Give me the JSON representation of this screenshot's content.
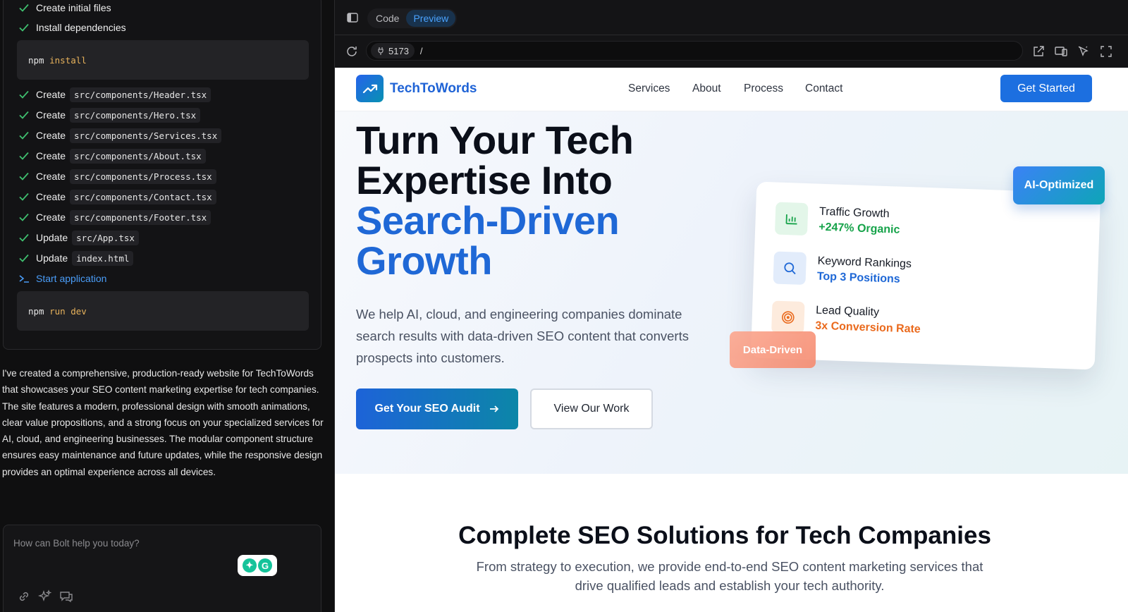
{
  "steps": [
    {
      "verb": "Create initial files",
      "file": ""
    },
    {
      "verb": "Install dependencies",
      "file": ""
    },
    {
      "verb": "Create",
      "file": "src/components/Header.tsx"
    },
    {
      "verb": "Create",
      "file": "src/components/Hero.tsx"
    },
    {
      "verb": "Create",
      "file": "src/components/Services.tsx"
    },
    {
      "verb": "Create",
      "file": "src/components/About.tsx"
    },
    {
      "verb": "Create",
      "file": "src/components/Process.tsx"
    },
    {
      "verb": "Create",
      "file": "src/components/Contact.tsx"
    },
    {
      "verb": "Create",
      "file": "src/components/Footer.tsx"
    },
    {
      "verb": "Update",
      "file": "src/App.tsx"
    },
    {
      "verb": "Update",
      "file": "index.html"
    },
    {
      "verb": "Start application",
      "file": ""
    }
  ],
  "terminals": [
    {
      "cmd": "npm",
      "arg": "install"
    },
    {
      "cmd": "npm",
      "arg": "run dev"
    }
  ],
  "summary": "I've created a comprehensive, production-ready website for TechToWords that showcases your SEO content marketing expertise for tech companies. The site features a modern, professional design with smooth animations, clear value propositions, and a strong focus on your specialized services for AI, cloud, and engineering businesses. The modular component structure ensures easy maintenance and future updates, while the responsive design provides an optimal experience across all devices.",
  "chat": {
    "placeholder": "How can Bolt help you today?"
  },
  "tabs": {
    "code": "Code",
    "preview": "Preview"
  },
  "address": {
    "port": "5173",
    "path": "/"
  },
  "site": {
    "brand": "TechToWords",
    "nav": [
      "Services",
      "About",
      "Process",
      "Contact"
    ],
    "cta": "Get Started",
    "hero": {
      "line1": "Turn Your Tech",
      "line2": "Expertise Into",
      "line3": "Search-Driven",
      "line4": "Growth",
      "desc": "We help AI, cloud, and engineering companies dominate search results with data-driven SEO content that converts prospects into customers.",
      "primary": "Get Your SEO Audit",
      "secondary": "View Our Work"
    },
    "metrics": [
      {
        "title": "Traffic Growth",
        "value": "+247% Organic",
        "color": "#16a34a",
        "bg": "#e3f6e9",
        "icon": "bar-chart-icon"
      },
      {
        "title": "Keyword Rankings",
        "value": "Top 3 Positions",
        "color": "#1f68d6",
        "bg": "#e2ecfb",
        "icon": "search-icon"
      },
      {
        "title": "Lead Quality",
        "value": "3x Conversion Rate",
        "color": "#ea6a1d",
        "bg": "#fdebdd",
        "icon": "target-icon"
      }
    ],
    "badges": {
      "ai": "AI-Optimized",
      "data": "Data-Driven"
    },
    "solutions": {
      "title": "Complete SEO Solutions for Tech Companies",
      "desc": "From strategy to execution, we provide end-to-end SEO content marketing services that drive qualified leads and establish your tech authority."
    }
  }
}
